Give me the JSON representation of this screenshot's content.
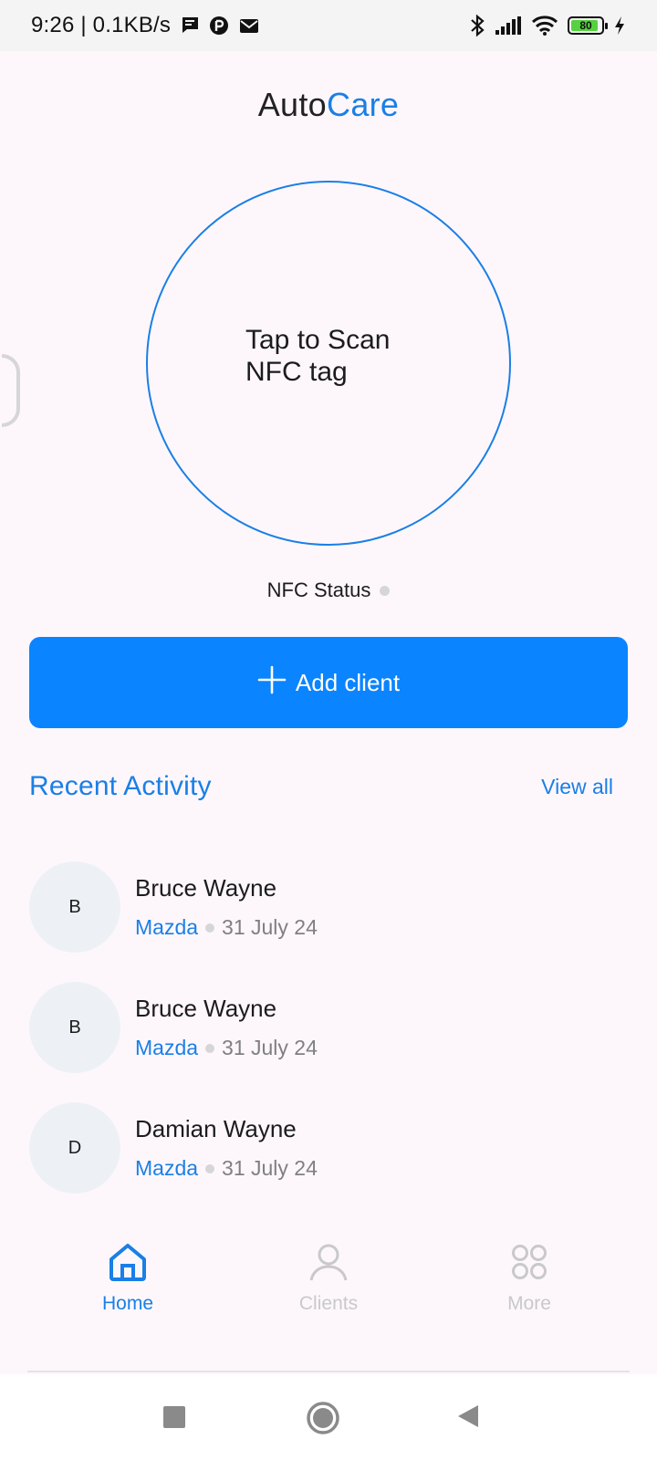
{
  "status_bar": {
    "time_speed": "9:26 | 0.1KB/s",
    "icons_left": [
      "message-icon",
      "p-badge-icon",
      "mail-icon"
    ],
    "icons_right": [
      "bluetooth-icon",
      "signal-icon",
      "wifi-icon",
      "battery-icon",
      "charging-icon"
    ],
    "battery_level": "80"
  },
  "app": {
    "title_part1": "Auto",
    "title_part2": "Care",
    "accent": "#1a7fe6"
  },
  "scan": {
    "text": "Tap to Scan NFC tag"
  },
  "nfc_status": {
    "label": "NFC Status"
  },
  "add_client": {
    "label": "Add client",
    "color": "#0a84ff"
  },
  "recent": {
    "title": "Recent Activity",
    "view_all": "View all",
    "items": [
      {
        "initial": "B",
        "name": "Bruce Wayne",
        "car": "Mazda",
        "date": "31 July 24"
      },
      {
        "initial": "B",
        "name": "Bruce Wayne",
        "car": "Mazda",
        "date": "31 July 24"
      },
      {
        "initial": "D",
        "name": "Damian Wayne",
        "car": "Mazda",
        "date": "31 July 24"
      }
    ]
  },
  "bottom_nav": {
    "items": [
      {
        "label": "Home",
        "icon": "home-icon",
        "active": true
      },
      {
        "label": "Clients",
        "icon": "user-icon",
        "active": false
      },
      {
        "label": "More",
        "icon": "grid-icon",
        "active": false
      }
    ]
  },
  "system_nav": {
    "buttons": [
      "recents-button",
      "home-button",
      "back-button"
    ]
  }
}
